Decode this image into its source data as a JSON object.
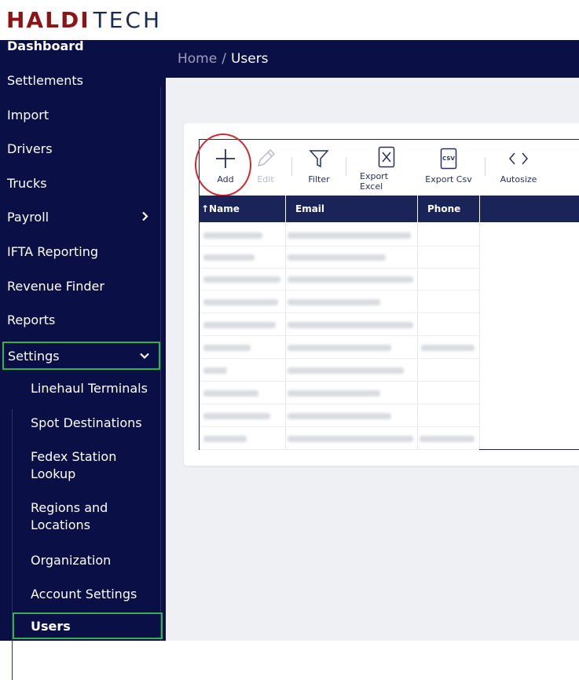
{
  "logo": {
    "part1": "HALDI",
    "part2": "TECH"
  },
  "sidebar": {
    "items": [
      {
        "label": "Dashboard"
      },
      {
        "label": "Settlements"
      },
      {
        "label": "Import"
      },
      {
        "label": "Drivers"
      },
      {
        "label": "Trucks"
      },
      {
        "label": "Payroll"
      },
      {
        "label": "IFTA Reporting"
      },
      {
        "label": "Revenue Finder"
      },
      {
        "label": "Reports"
      },
      {
        "label": "Settings"
      }
    ],
    "settings_sub": [
      {
        "label": "Linehaul Terminals"
      },
      {
        "label": "Spot Destinations"
      },
      {
        "label": "Fedex Station Lookup"
      },
      {
        "label": "Regions and Locations"
      },
      {
        "label": "Organization"
      },
      {
        "label": "Account Settings"
      },
      {
        "label": "Users"
      }
    ]
  },
  "breadcrumb": {
    "home": "Home",
    "separator": "/",
    "current": "Users"
  },
  "toolbar": {
    "add": "Add",
    "edit": "Edit",
    "filter": "Filter",
    "export_excel": "Export Excel",
    "export_csv": "Export Csv",
    "csv_icon_text": "CSV",
    "autosize": "Autosize"
  },
  "table": {
    "columns": [
      {
        "label": "↑Name"
      },
      {
        "label": "Email"
      },
      {
        "label": "Phone"
      }
    ],
    "row_count": 10
  },
  "colors": {
    "navy": "#0a1046",
    "header_navy": "#1a2459",
    "active_outline": "#2fb34a",
    "highlight_circle": "#d0282e",
    "logo_red": "#8c1414"
  }
}
